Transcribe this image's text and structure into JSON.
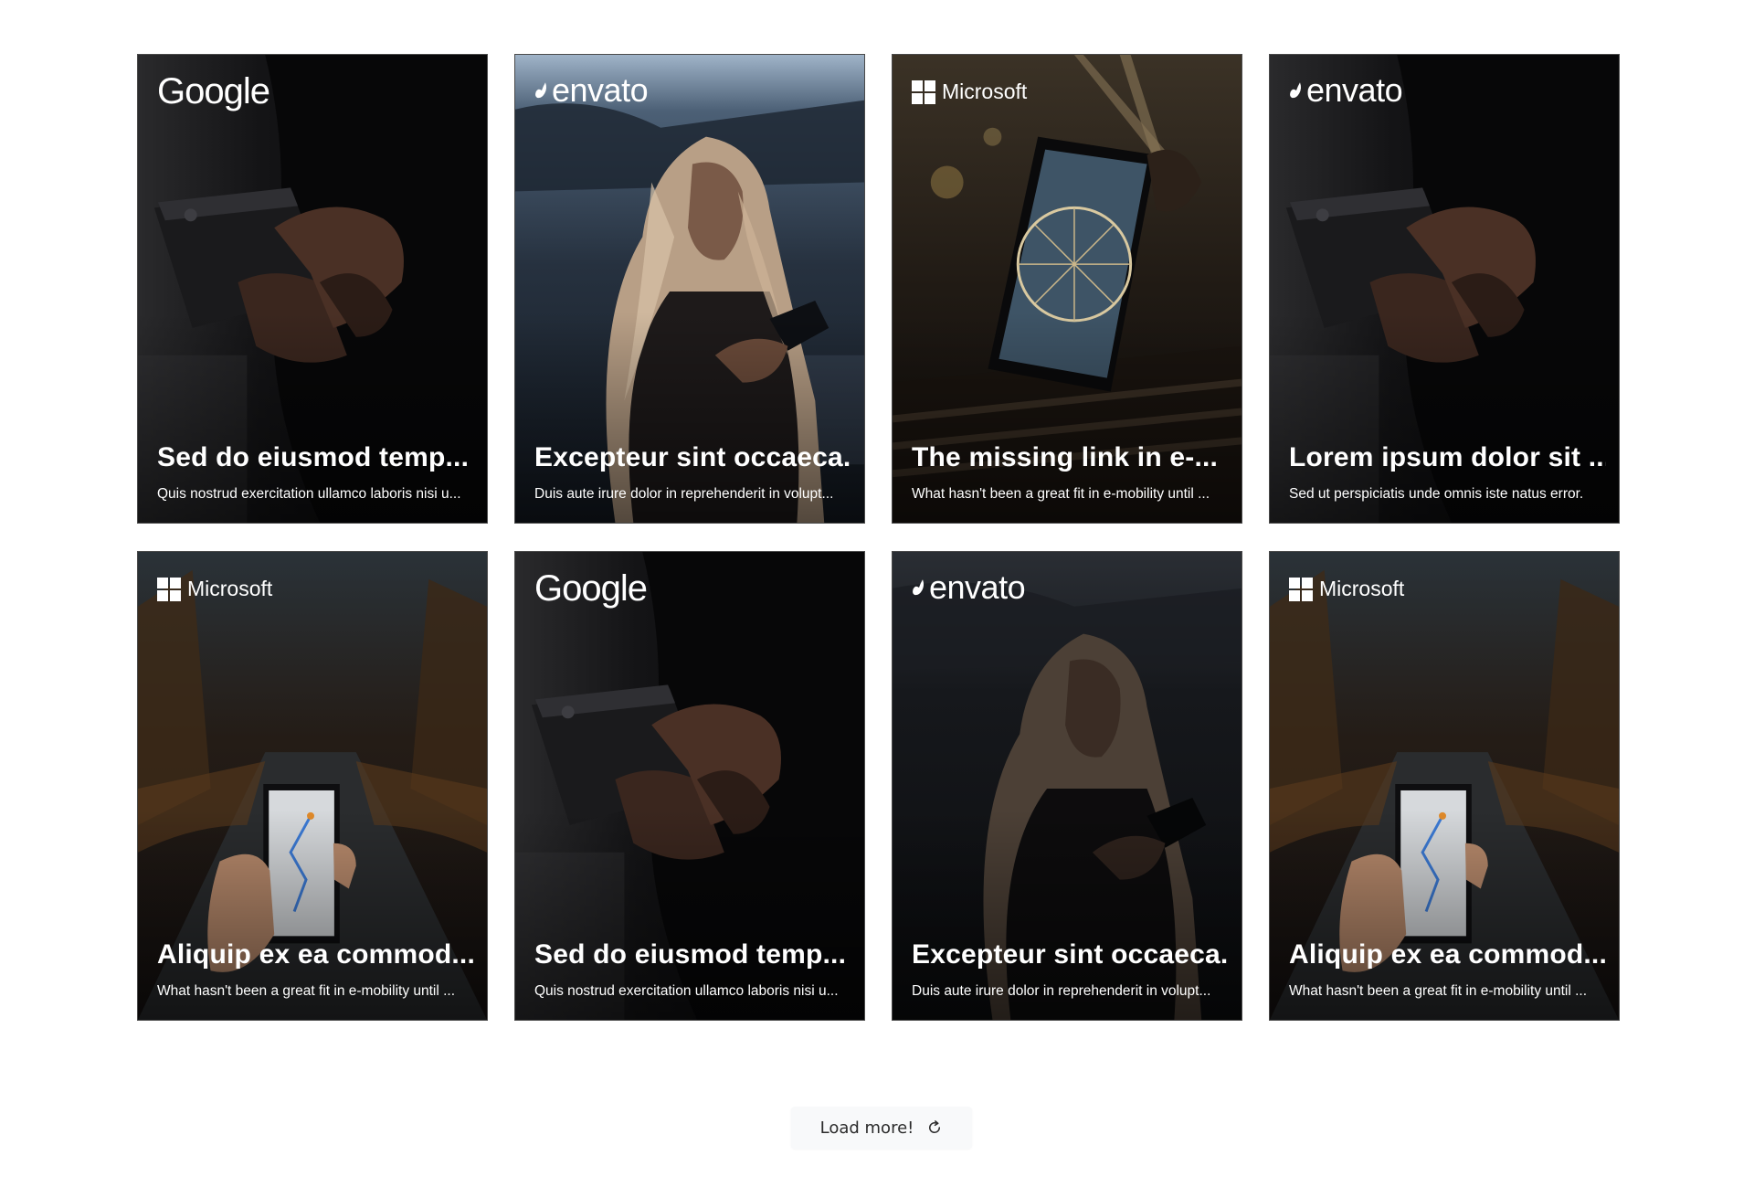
{
  "cards": [
    {
      "brand": "Google",
      "logo_text": "Google",
      "title": "Sed do eiusmod temp...",
      "description": "Quis nostrud exercitation ullamco laboris nisi u...",
      "scene": "hand-phone-dark"
    },
    {
      "brand": "envato",
      "logo_text": "envato",
      "title": "Excepteur sint occaeca...",
      "description": "Duis aute irure dolor in reprehenderit in volupt...",
      "scene": "woman-phone-night"
    },
    {
      "brand": "Microsoft",
      "logo_text": "Microsoft",
      "title": "The missing link in e-...",
      "description": "What hasn't been a great fit in e-mobility until ...",
      "scene": "phone-ferris-wheel"
    },
    {
      "brand": "envato",
      "logo_text": "envato",
      "title": "Lorem ipsum dolor sit ...",
      "description": "Sed ut perspiciatis unde omnis iste natus error.",
      "scene": "hand-phone-dark"
    },
    {
      "brand": "Microsoft",
      "logo_text": "Microsoft",
      "title": "Aliquip ex ea commod...",
      "description": "What hasn't been a great fit in e-mobility until ...",
      "scene": "phone-map-road"
    },
    {
      "brand": "Google",
      "logo_text": "Google",
      "title": "Sed do eiusmod temp...",
      "description": "Quis nostrud exercitation ullamco laboris nisi u...",
      "scene": "hand-phone-dark"
    },
    {
      "brand": "envato",
      "logo_text": "envato",
      "title": "Excepteur sint occaeca...",
      "description": "Duis aute irure dolor in reprehenderit in volupt...",
      "scene": "woman-phone-dim"
    },
    {
      "brand": "Microsoft",
      "logo_text": "Microsoft",
      "title": "Aliquip ex ea commod...",
      "description": "What hasn't been a great fit in e-mobility until ...",
      "scene": "phone-map-road"
    }
  ],
  "load_more": {
    "label": "Load more!",
    "icon": "reload-icon"
  },
  "colors": {
    "page_background": "#ffffff",
    "card_text": "#ffffff",
    "button_background": "#f8f9fa",
    "button_text": "#2b2b2b"
  }
}
